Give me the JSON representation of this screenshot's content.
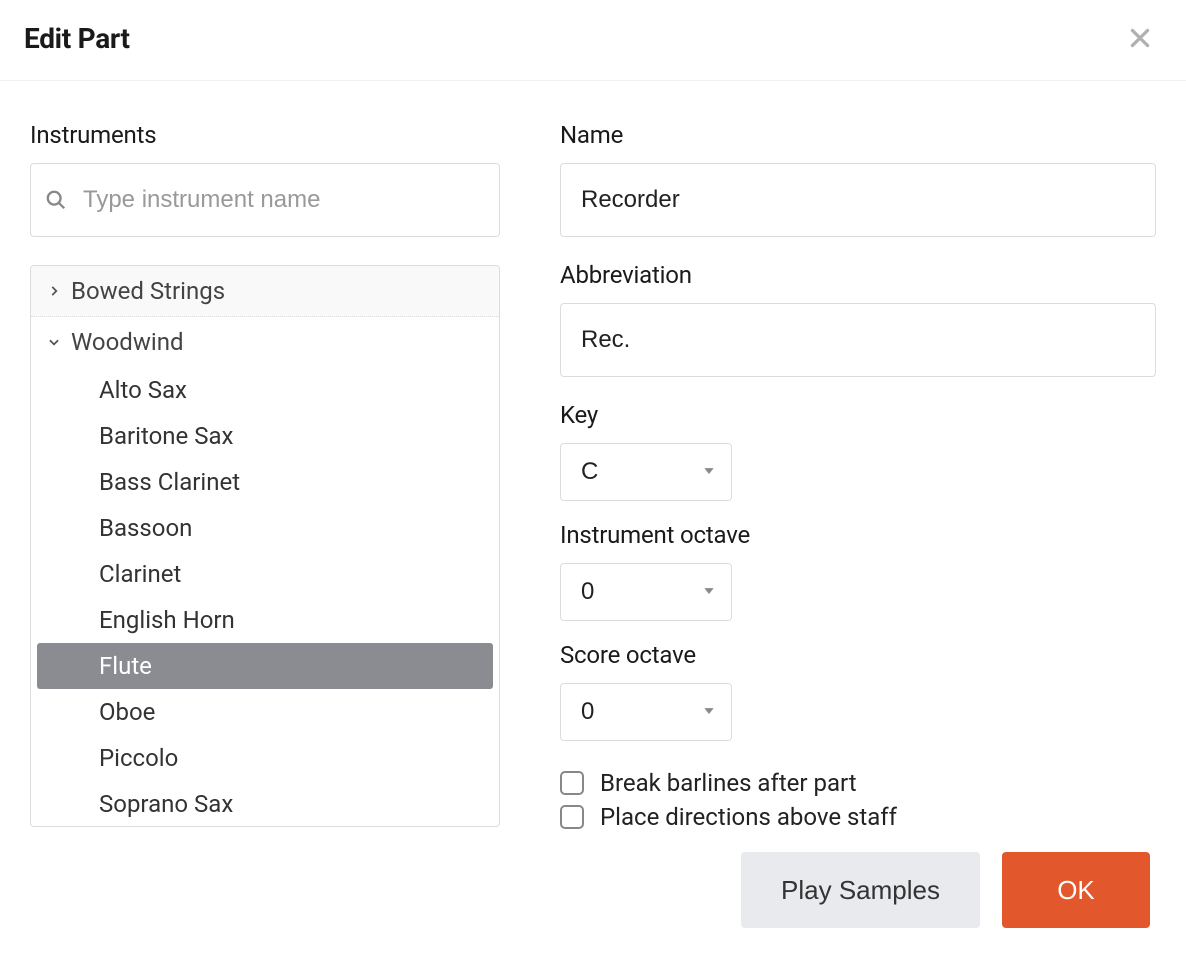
{
  "dialog": {
    "title": "Edit Part"
  },
  "left": {
    "label": "Instruments",
    "search_placeholder": "Type instrument name",
    "groups": [
      {
        "name": "Bowed Strings",
        "expanded": false
      },
      {
        "name": "Woodwind",
        "expanded": true
      }
    ],
    "woodwind_items": [
      "Alto Sax",
      "Baritone Sax",
      "Bass Clarinet",
      "Bassoon",
      "Clarinet",
      "English Horn",
      "Flute",
      "Oboe",
      "Piccolo",
      "Soprano Sax"
    ],
    "selected_item": "Flute"
  },
  "right": {
    "name_label": "Name",
    "name_value": "Recorder",
    "abbrev_label": "Abbreviation",
    "abbrev_value": "Rec.",
    "key_label": "Key",
    "key_value": "C",
    "instr_oct_label": "Instrument octave",
    "instr_oct_value": "0",
    "score_oct_label": "Score octave",
    "score_oct_value": "0",
    "check_break": "Break barlines after part",
    "check_directions": "Place directions above staff"
  },
  "footer": {
    "play": "Play Samples",
    "ok": "OK"
  }
}
